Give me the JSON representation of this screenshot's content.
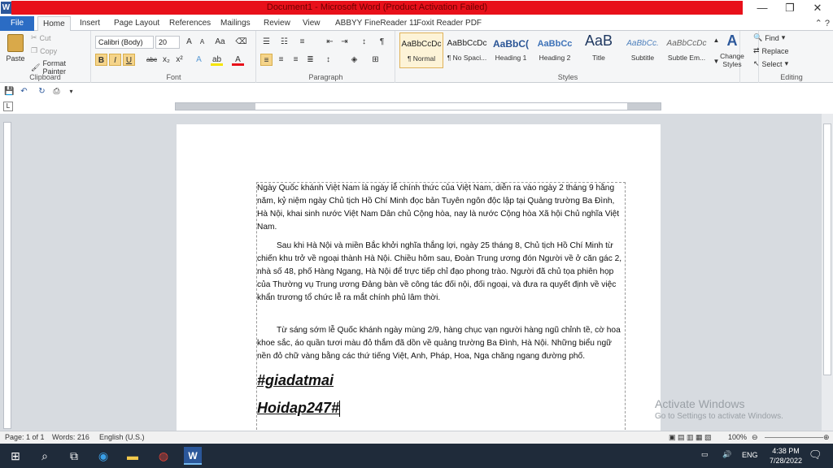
{
  "window": {
    "title": "Document1 - Microsoft Word (Product Activation Failed)",
    "app_icon": "W",
    "minimize": "—",
    "maximize": "❐",
    "close": "✕"
  },
  "tabs": [
    "File",
    "Home",
    "Insert",
    "Page Layout",
    "References",
    "Mailings",
    "Review",
    "View",
    "ABBYY FineReader 11",
    "Foxit Reader PDF"
  ],
  "clipboard": {
    "paste": "Paste",
    "cut": "Cut",
    "copy": "Copy",
    "format_painter": "Format Painter",
    "label": "Clipboard"
  },
  "font": {
    "name": "Calibri (Body)",
    "size": "20",
    "label": "Font",
    "bold": "B",
    "italic": "I",
    "underline": "U",
    "strike": "abc",
    "subscript": "x₂",
    "superscript": "x²",
    "grow": "A",
    "shrink": "A",
    "change_case": "Aa",
    "text_effects": "A",
    "highlight": "ab",
    "font_color": "A"
  },
  "paragraph": {
    "label": "Paragraph",
    "show_marks": "¶"
  },
  "styles": {
    "label": "Styles",
    "items": [
      {
        "sample": "AaBbCcDc",
        "name": "¶ Normal"
      },
      {
        "sample": "AaBbCcDc",
        "name": "¶ No Spaci..."
      },
      {
        "sample": "AaBbC(",
        "name": "Heading 1"
      },
      {
        "sample": "AaBbCc",
        "name": "Heading 2"
      },
      {
        "sample": "AaB",
        "name": "Title"
      },
      {
        "sample": "AaBbCc.",
        "name": "Subtitle"
      },
      {
        "sample": "AaBbCcDc",
        "name": "Subtle Em..."
      }
    ],
    "change_styles": "Change Styles"
  },
  "editing": {
    "label": "Editing",
    "find": "Find",
    "replace": "Replace",
    "select": "Select"
  },
  "document": {
    "p1": "Ngày Quốc khánh Việt Nam là ngày lễ chính thức của Việt Nam, diễn ra vào ngày 2 tháng 9 hằng năm, kỷ niệm ngày Chủ tịch Hồ Chí Minh đọc bản Tuyên ngôn độc lập tại Quảng trường Ba Đình, Hà Nội, khai sinh nước Việt Nam Dân chủ Cộng hòa, nay là nước Cộng hòa Xã hội Chủ nghĩa Việt Nam.",
    "p2": "Sau khi Hà Nội và miền Bắc khởi nghĩa thắng lợi, ngày 25 tháng 8, Chủ tịch Hồ Chí Minh từ chiến khu trở về ngoại thành Hà Nội. Chiều hôm sau, Đoàn Trung ương đón Người về ở căn gác 2, nhà số 48, phố Hàng Ngang, Hà Nội để trực tiếp chỉ đạo phong trào. Người đã chủ tọa phiên họp của Thường vụ Trung ương Đảng bàn về công tác đối nội, đối ngoại, và đưa ra quyết định về việc khẩn trương tổ chức lễ ra mắt chính phủ lâm thời.",
    "p3": "Từ sáng sớm lễ Quốc khánh ngày mùng 2/9, hàng chục vạn người hàng ngũ chỉnh tề, cờ hoa khoe sắc, áo quần tươi màu đỏ thắm đã dồn về quảng trường Ba Đình, Hà Nội. Những biểu ngữ nền đỏ chữ vàng bằng các thứ tiếng Việt, Anh, Pháp, Hoa, Nga chăng ngang đường phố.",
    "tag1": "#giadatmai",
    "tag2": "Hoidap247#"
  },
  "watermark": {
    "line1": "Activate Windows",
    "line2": "Go to Settings to activate Windows."
  },
  "status": {
    "page": "Page: 1 of 1",
    "words": "Words: 216",
    "language": "English (U.S.)",
    "zoom": "100%"
  },
  "taskbar": {
    "lang": "ENG",
    "time": "4:38 PM",
    "date": "7/28/2022"
  },
  "colors": {
    "titlebar_red": "#e8101a",
    "file_tab": "#2b6cc4",
    "taskbar": "#1f2b3a"
  }
}
